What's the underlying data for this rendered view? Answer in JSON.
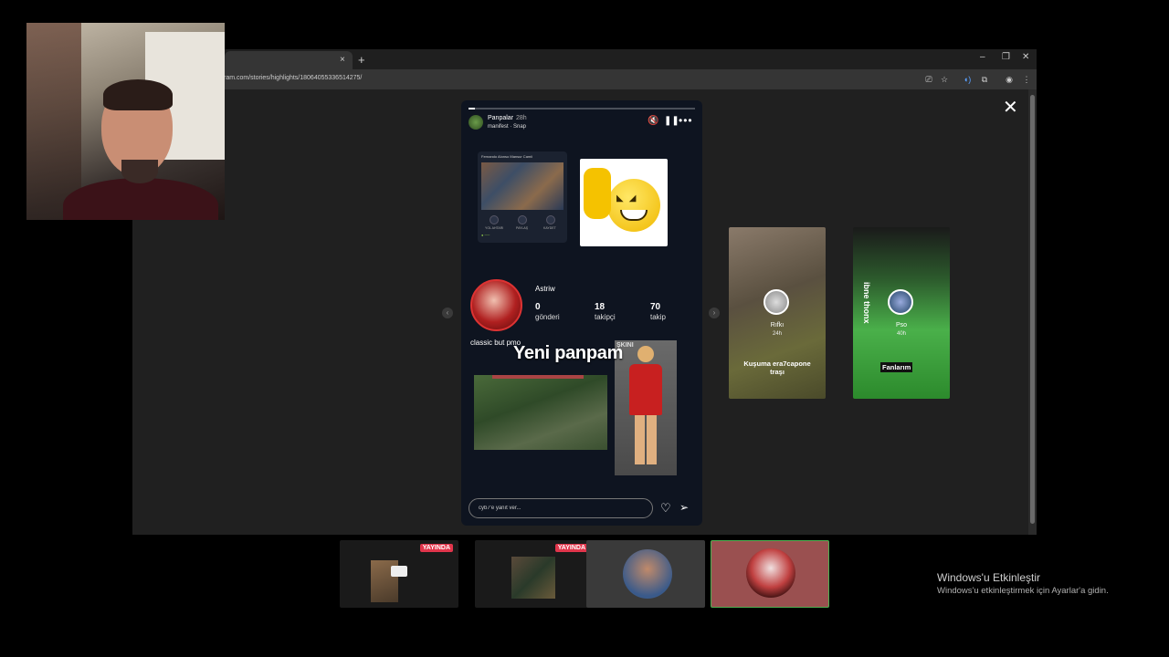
{
  "browser": {
    "url": "ram.com/stories/highlights/18064055336514275/",
    "tab_close": "×",
    "new_tab": "+",
    "minimize": "–",
    "restore": "❐",
    "close": "✕"
  },
  "story": {
    "user": "Panpalar",
    "time": "28h",
    "music": "manifest · Snap",
    "progress_fraction": 0.03,
    "card_title": "Fernando Alonso Mansur Camii",
    "card_buttons": [
      "YOL AHTARI",
      "PAYLAŞ",
      "KAYDET"
    ],
    "profile": {
      "name": "Astriw",
      "stats": [
        {
          "num": "0",
          "label": "gönderi"
        },
        {
          "num": "18",
          "label": "takipçi"
        },
        {
          "num": "70",
          "label": "takip"
        }
      ]
    },
    "caption_small": "classic but pmo",
    "caption_big": "Yeni panpam",
    "player_tag": "ŞKINI",
    "reply_placeholder": "cyb7'e yanıt ver..."
  },
  "side_stories": [
    {
      "name": "Rıfkı",
      "time": "24h",
      "caption": "Kuşuma era7capone traşı"
    },
    {
      "name": "Pso",
      "time": "40h",
      "vertical_text": "ibne thonx",
      "badge": "Fanlarım"
    }
  ],
  "taskbar": {
    "thumbs": [
      {
        "badge": "YAYINDA"
      },
      {
        "badge": "YAYINDA"
      },
      {},
      {}
    ]
  },
  "windows": {
    "title": "Windows'u Etkinleştir",
    "subtitle": "Windows'u etkinleştirmek için Ayarlar'a gidin."
  }
}
